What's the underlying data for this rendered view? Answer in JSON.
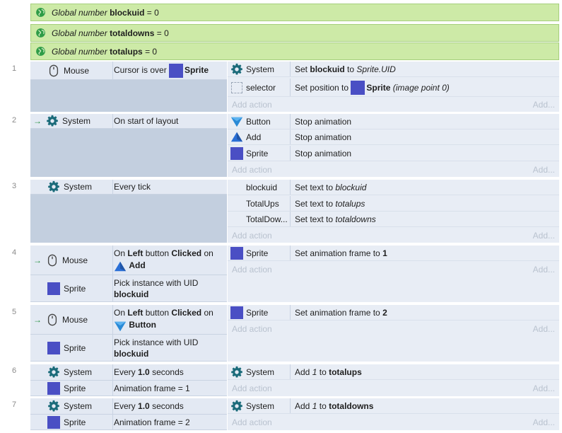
{
  "globals": [
    {
      "prefix": "Global number",
      "name": "blockuid",
      "suffix": "= 0"
    },
    {
      "prefix": "Global number",
      "name": "totaldowns",
      "suffix": "= 0"
    },
    {
      "prefix": "Global number",
      "name": "totalups",
      "suffix": "= 0"
    }
  ],
  "add_action_label": "Add action",
  "add_label": "Add...",
  "events": [
    {
      "num": "1",
      "conditions": [
        {
          "object": "Mouse",
          "icon": "mouse-icon",
          "pre": "Cursor is over",
          "sprite": "Sprite"
        }
      ],
      "actions": [
        {
          "object": "System",
          "icon": "gear-icon",
          "pre": "Set",
          "bold": "blockuid",
          "mid": "to",
          "italic": "Sprite.UID"
        },
        {
          "object": "selector",
          "icon": "dashed-box-icon",
          "pre": "Set position to",
          "sprite": "Sprite",
          "italic": "(image point 0)"
        }
      ]
    },
    {
      "num": "2",
      "conditions": [
        {
          "object": "System",
          "icon": "gear-icon",
          "trigger": true,
          "text": "On start of layout"
        }
      ],
      "actions": [
        {
          "object": "Button",
          "icon": "triangle-down-icon",
          "text": "Stop animation"
        },
        {
          "object": "Add",
          "icon": "triangle-up-icon",
          "text": "Stop animation"
        },
        {
          "object": "Sprite",
          "icon": "sprite-icon",
          "text": "Stop animation"
        }
      ]
    },
    {
      "num": "3",
      "conditions": [
        {
          "object": "System",
          "icon": "gear-icon",
          "text": "Every tick"
        }
      ],
      "actions": [
        {
          "object": "blockuid",
          "pre": "Set text to",
          "italic": "blockuid"
        },
        {
          "object": "TotalUps",
          "pre": "Set text to",
          "italic": "totalups"
        },
        {
          "object": "TotalDow...",
          "pre": "Set text to",
          "italic": "totaldowns"
        }
      ]
    },
    {
      "num": "4",
      "conditions": [
        {
          "object": "Mouse",
          "icon": "mouse-icon",
          "trigger": true,
          "l1a": "On",
          "l1b": "Left",
          "l1c": "button",
          "l1d": "Clicked",
          "l1e": "on",
          "target": "Add"
        },
        {
          "object": "Sprite",
          "icon": "sprite-icon",
          "line1": "Pick instance with UID",
          "line2": "blockuid"
        }
      ],
      "actions": [
        {
          "object": "Sprite",
          "icon": "sprite-icon",
          "pre": "Set animation frame to",
          "bold": "1"
        }
      ]
    },
    {
      "num": "5",
      "conditions": [
        {
          "object": "Mouse",
          "icon": "mouse-icon",
          "trigger": true,
          "l1a": "On",
          "l1b": "Left",
          "l1c": "button",
          "l1d": "Clicked",
          "l1e": "on",
          "target": "Button"
        },
        {
          "object": "Sprite",
          "icon": "sprite-icon",
          "line1": "Pick instance with UID",
          "line2": "blockuid"
        }
      ],
      "actions": [
        {
          "object": "Sprite",
          "icon": "sprite-icon",
          "pre": "Set animation frame to",
          "bold": "2"
        }
      ]
    },
    {
      "num": "6",
      "conditions": [
        {
          "object": "System",
          "icon": "gear-icon",
          "pre": "Every",
          "bold": "1.0",
          "post": "seconds"
        },
        {
          "object": "Sprite",
          "icon": "sprite-icon",
          "text": "Animation frame = 1"
        }
      ],
      "actions": [
        {
          "object": "System",
          "icon": "gear-icon",
          "pre": "Add",
          "italic": "1",
          "mid": "to",
          "bold": "totalups"
        }
      ]
    },
    {
      "num": "7",
      "conditions": [
        {
          "object": "System",
          "icon": "gear-icon",
          "pre": "Every",
          "bold": "1.0",
          "post": "seconds"
        },
        {
          "object": "Sprite",
          "icon": "sprite-icon",
          "text": "Animation frame = 2"
        }
      ],
      "actions": [
        {
          "object": "System",
          "icon": "gear-icon",
          "pre": "Add",
          "italic": "1",
          "mid": "to",
          "bold": "totaldowns"
        }
      ]
    }
  ]
}
